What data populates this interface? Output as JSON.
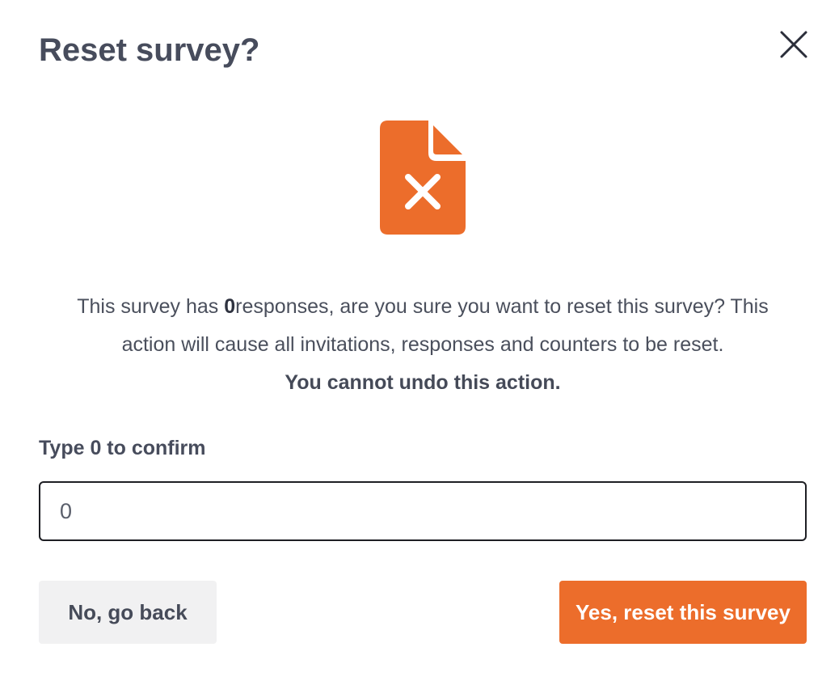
{
  "dialog": {
    "title": "Reset survey?",
    "close_icon": "close-icon",
    "illustration_icon": "file-cross-icon",
    "message": {
      "part1": "This survey has ",
      "count": "0",
      "part2": "responses, are you sure you want to reset this survey? This",
      "line2": "action will cause all invitations, responses and counters to be reset.",
      "warning": "You cannot undo this action."
    },
    "confirm_label": "Type 0 to confirm",
    "confirm_value": "0",
    "cancel_label": "No, go back",
    "confirm_button_label": "Yes, reset this survey"
  },
  "colors": {
    "accent": "#ec6d2b",
    "text": "#4a4f5c",
    "secondary_button_bg": "#f1f1f2"
  }
}
